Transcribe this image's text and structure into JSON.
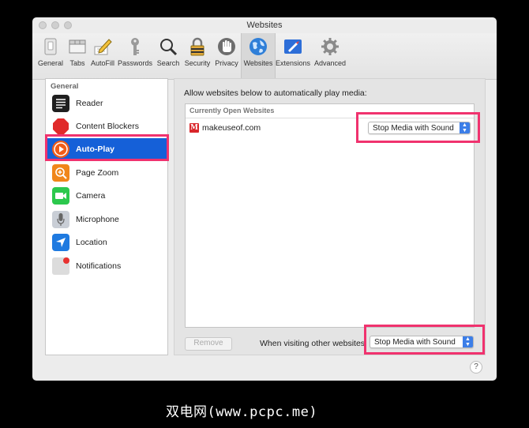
{
  "window": {
    "title": "Websites"
  },
  "toolbar": {
    "items": [
      {
        "label": "General",
        "icon": "general-switch-icon"
      },
      {
        "label": "Tabs",
        "icon": "tabs-icon"
      },
      {
        "label": "AutoFill",
        "icon": "autofill-pencil-icon"
      },
      {
        "label": "Passwords",
        "icon": "key-icon"
      },
      {
        "label": "Search",
        "icon": "magnifier-icon"
      },
      {
        "label": "Security",
        "icon": "padlock-icon"
      },
      {
        "label": "Privacy",
        "icon": "hand-icon"
      },
      {
        "label": "Websites",
        "icon": "globe-icon"
      },
      {
        "label": "Extensions",
        "icon": "extensions-icon"
      },
      {
        "label": "Advanced",
        "icon": "gear-icon"
      }
    ],
    "selected": "Websites"
  },
  "sidebar": {
    "header": "General",
    "items": [
      {
        "label": "Reader",
        "icon": "reader-icon"
      },
      {
        "label": "Content Blockers",
        "icon": "stop-sign-icon"
      },
      {
        "label": "Auto-Play",
        "icon": "play-icon"
      },
      {
        "label": "Page Zoom",
        "icon": "zoom-icon"
      },
      {
        "label": "Camera",
        "icon": "camera-icon"
      },
      {
        "label": "Microphone",
        "icon": "microphone-icon"
      },
      {
        "label": "Location",
        "icon": "location-arrow-icon"
      },
      {
        "label": "Notifications",
        "icon": "notification-badge-icon"
      }
    ],
    "selected": "Auto-Play"
  },
  "pane": {
    "title": "Allow websites below to automatically play media:",
    "list_header": "Currently Open Websites",
    "rows": [
      {
        "site": "makeuseof.com",
        "favicon_letter": "M",
        "setting": "Stop Media with Sound"
      }
    ],
    "remove_button": "Remove",
    "other_label": "When visiting other websites:",
    "other_setting": "Stop Media with Sound"
  },
  "help": "?",
  "watermark": "双电网(www.pcpc.me)",
  "colors": {
    "selection": "#1560d8",
    "highlight": "#f0326e",
    "popup_stepper": "#3c7ee8"
  }
}
